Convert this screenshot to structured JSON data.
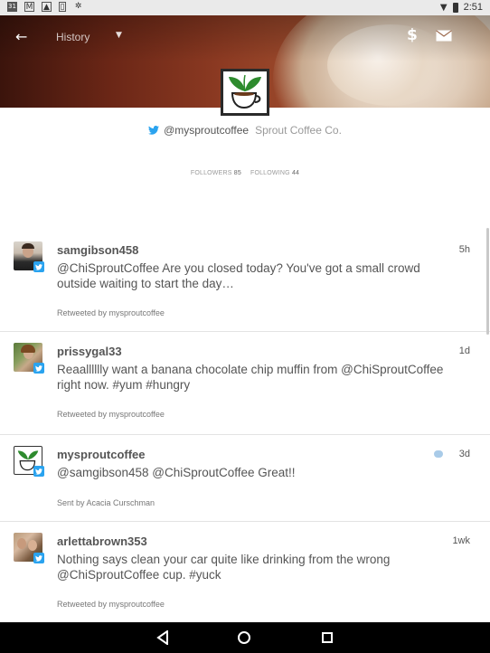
{
  "status_bar": {
    "icons_left": [
      "calendar-icon",
      "gmail-icon",
      "image-icon",
      "sim-icon",
      "settings-icon"
    ],
    "calendar_day": "31",
    "time": "2:51"
  },
  "header": {
    "history_label": "History",
    "actions": [
      "dollar-icon",
      "mail-icon"
    ]
  },
  "profile": {
    "handle": "@mysproutcoffee",
    "company": "Sprout Coffee Co.",
    "followers_label": "FOLLOWERS",
    "followers_count": "85",
    "following_label": "FOLLOWING",
    "following_count": "44"
  },
  "tweets": [
    {
      "username": "samgibson458",
      "time": "5h",
      "text": "@ChiSproutCoffee Are you closed today? You've got a small crowd outside waiting to start the day…",
      "meta": "Retweeted by mysproutcoffee"
    },
    {
      "username": "prissygal33",
      "time": "1d",
      "text": "Reaalllllly want a banana chocolate chip muffin from @ChiSproutCoffee right now. #yum #hungry",
      "meta": "Retweeted by mysproutcoffee"
    },
    {
      "username": "mysproutcoffee",
      "time": "3d",
      "text": "@samgibson458 @ChiSproutCoffee Great!!",
      "meta": "Sent by Acacia Curschman"
    },
    {
      "username": "arlettabrown353",
      "time": "1wk",
      "text": "Nothing says clean your car quite like drinking from the wrong @ChiSproutCoffee cup. #yuck",
      "meta": "Retweeted by mysproutcoffee"
    }
  ],
  "colors": {
    "twitter_blue": "#2aa3ef",
    "header_brown": "#8c3a22",
    "sprout_green": "#2e8b2e"
  }
}
